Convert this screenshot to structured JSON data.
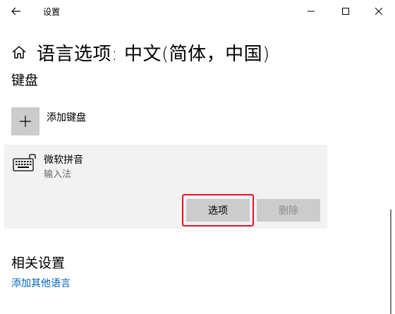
{
  "window": {
    "title": "设置",
    "back_icon": "arrow-left-icon",
    "controls": [
      "minimize-icon",
      "maximize-icon",
      "close-icon"
    ]
  },
  "page": {
    "title": "语言选项: 中文(简体，中国)",
    "home_icon": "home-icon"
  },
  "keyboard_section": {
    "heading": "键盘",
    "add_label": "添加键盘",
    "add_icon": "plus-icon"
  },
  "ime": {
    "name": "微软拼音",
    "type": "输入法",
    "icon": "keyboard-icon",
    "options_label": "选项",
    "delete_label": "删除"
  },
  "related_section": {
    "heading": "相关设置",
    "link_add_language": "添加其他语言"
  },
  "colors": {
    "accent_link": "#0066b4",
    "highlight": "#e81123",
    "card_bg": "#f2f2f2",
    "button_bg": "#cccccc"
  }
}
